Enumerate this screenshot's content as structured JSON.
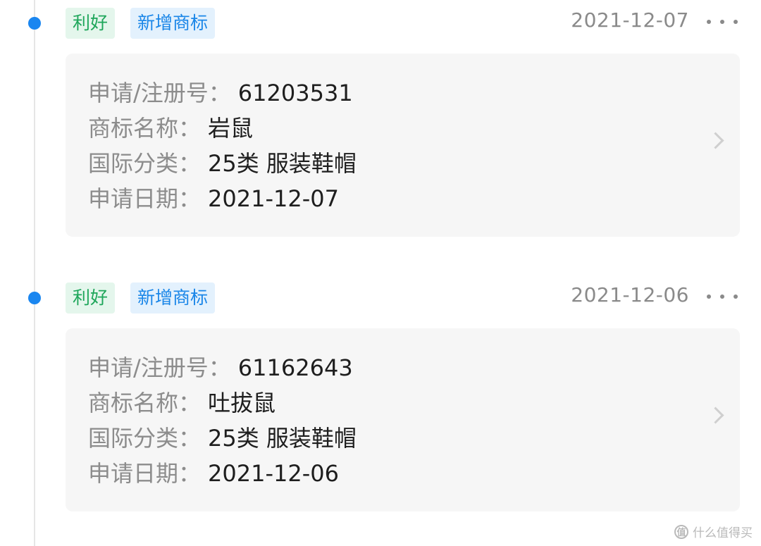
{
  "entries": [
    {
      "tag_good": "利好",
      "tag_type": "新增商标",
      "date": "2021-12-07",
      "rows": [
        {
          "label": "申请/注册号：",
          "value": "61203531"
        },
        {
          "label": "商标名称：",
          "value": "岩鼠"
        },
        {
          "label": "国际分类：",
          "value": "25类 服装鞋帽"
        },
        {
          "label": "申请日期：",
          "value": "2021-12-07"
        }
      ]
    },
    {
      "tag_good": "利好",
      "tag_type": "新增商标",
      "date": "2021-12-06",
      "rows": [
        {
          "label": "申请/注册号：",
          "value": "61162643"
        },
        {
          "label": "商标名称：",
          "value": "吐拔鼠"
        },
        {
          "label": "国际分类：",
          "value": "25类 服装鞋帽"
        },
        {
          "label": "申请日期：",
          "value": "2021-12-06"
        }
      ]
    }
  ],
  "watermark": {
    "icon": "值",
    "text": "什么值得买"
  },
  "colors": {
    "accent": "#1a86f0",
    "tag_good": "#1ea65a",
    "tag_new": "#1a86e8"
  },
  "icons": {
    "more": "more-dots-icon",
    "chevron": "chevron-right-icon",
    "dot": "timeline-dot-icon"
  }
}
